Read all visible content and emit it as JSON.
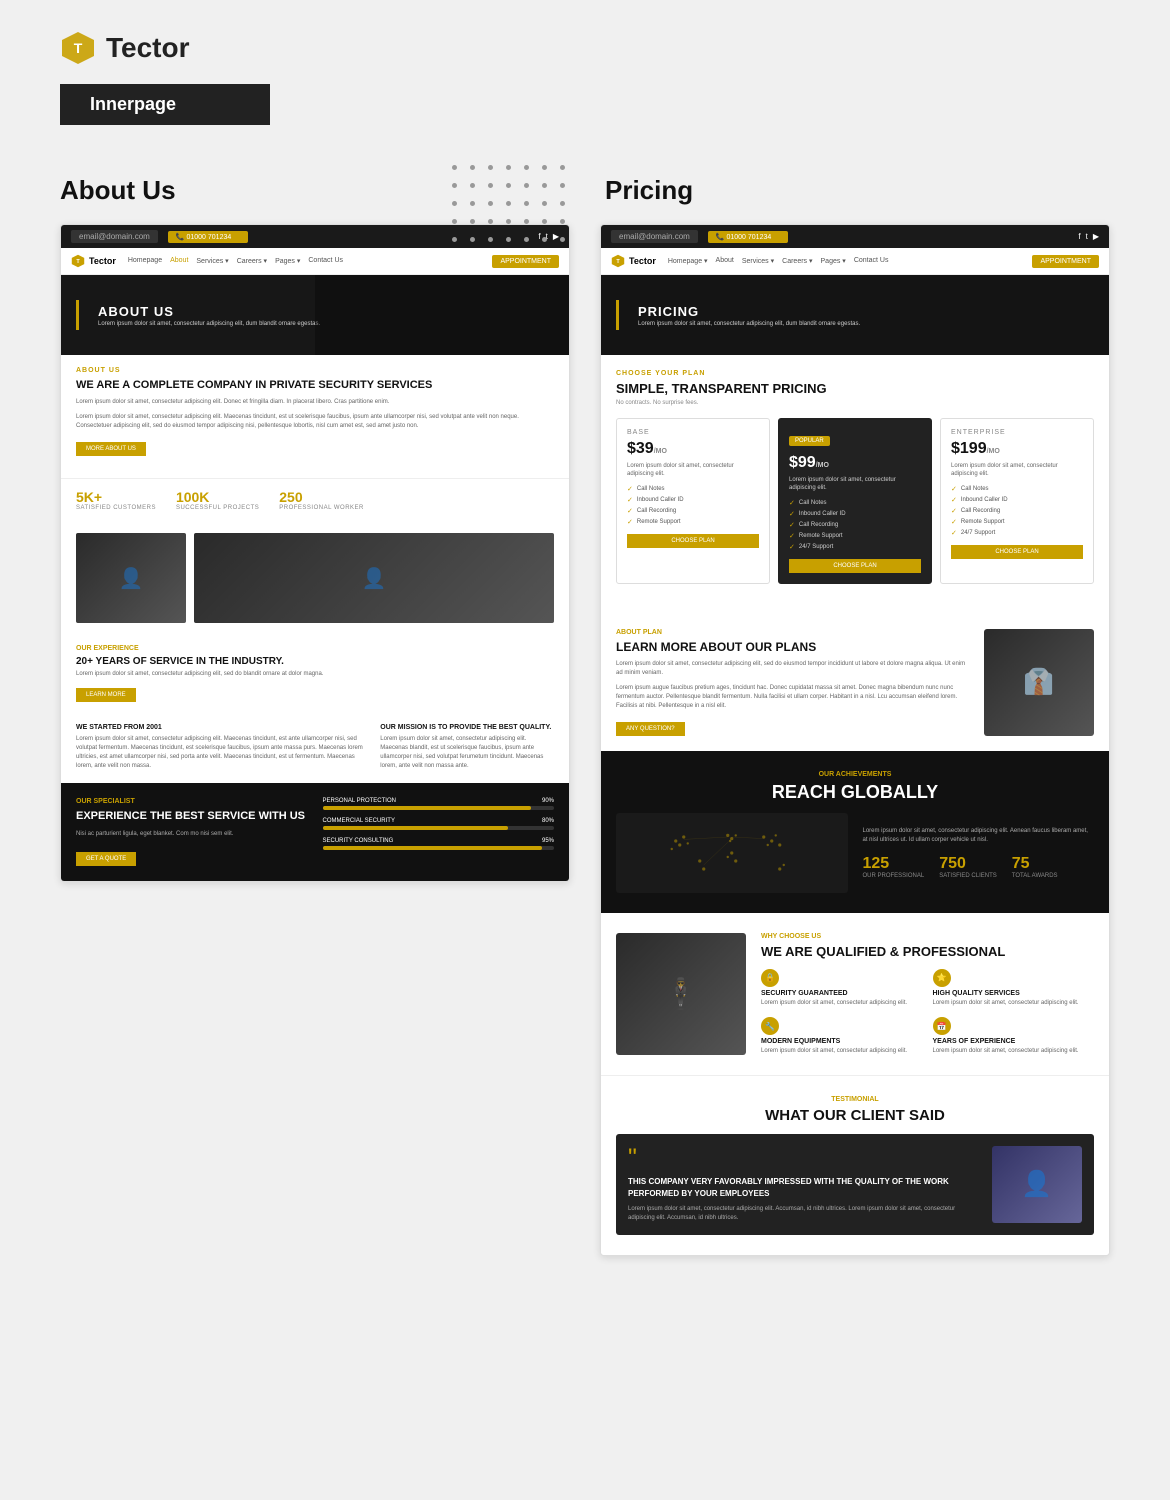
{
  "brand": {
    "name": "Tector",
    "logo_label": "tector-logo"
  },
  "left_section": {
    "badge": "Innerpage",
    "title": "About Us",
    "hero": {
      "title": "ABOUT US",
      "subtitle": "Lorem ipsum dolor sit amet, consectetur adipiscing elit, dum blandit ornare egestas."
    },
    "about": {
      "label": "ABOUT US",
      "heading": "WE ARE A COMPLETE COMPANY IN PRIVATE SECURITY SERVICES",
      "text1": "Lorem ipsum dolor sit amet, consectetur adipiscing elit. Donec et fringilla diam. In placerat libero. Cras partitione enim.",
      "text2": "Lorem ipsum dolor sit amet, consectetur adipiscing elit. Maecenas tincidunt, est ut scelerisque faucibus, ipsum ante ullamcorper nisi, sed volutpat ante velit non neque. Consectetuer adipiscing elit, sed do eiusmod tempor adipiscing nisi, pellentesque lobortis, nisl cum amet est, sed amet justo non.",
      "btn_more": "MORE ABOUT US"
    },
    "stats": [
      {
        "num": "5K+",
        "label": "SATISFIED CUSTOMERS"
      },
      {
        "num": "100K",
        "label": "SUCCESSFUL PROJECTS"
      },
      {
        "num": "250",
        "label": "PROFESSIONAL WORKER"
      }
    ],
    "experience": {
      "label": "OUR EXPERIENCE",
      "heading": "20+ YEARS OF SERVICE IN THE INDUSTRY.",
      "text": "Lorem ipsum dolor sit amet, consectetur adipiscing elit, sed do blandit ornare at dolor magna.",
      "btn": "LEARN MORE"
    },
    "two_col": {
      "col1_title": "WE STARTED FROM 2001",
      "col1_text": "Lorem ipsum dolor sit amet, consectetur adipiscing elit. Maecenas tincidunt, est ante ullamcorper nisi, sed volutpat fermentum. Maecenas tincidunt, est scelerisque faucibus, ipsum ante massa purs. Maecenas lorem ultricies, est amet ullamcorper nisi, sed porta ante velit. Maecenas tincidunt, est ut fermentum. Maecenas lorem, ante velit non massa.",
      "col2_title": "OUR MISSION IS TO PROVIDE THE BEST QUALITY.",
      "col2_text": "Lorem ipsum dolor sit amet, consectetur adipiscing elit. Maecenas blandit, est ut scelerisque faucibus, ipsum ante ullamcorper nisi, sed volutpat ferumetum tincidunt. Maecenas lorem, ante velit non massa ante."
    },
    "footer": {
      "label": "OUR SPECIALIST",
      "heading": "EXPERIENCE THE BEST SERVICE WITH US",
      "text": "Nisi ac parturient ligula, eget blanket. Com mo nisi sem elit.",
      "btn_quote": "GET A QUOTE",
      "progress_bars": [
        {
          "label": "PERSONAL PROTECTION",
          "pct": "90%",
          "value": 90
        },
        {
          "label": "COMMERCIAL SECURITY",
          "pct": "80%",
          "value": 80
        },
        {
          "label": "SECURITY CONSULTING",
          "pct": "95%",
          "value": 95
        }
      ]
    }
  },
  "right_section": {
    "title": "Pricing",
    "nav": {
      "links": [
        "Homepage",
        "About",
        "Services",
        "Careers",
        "Pages",
        "Contact Us"
      ],
      "active": "About",
      "btn": "APPOINTMENT"
    },
    "hero": {
      "title": "PRICING",
      "text": "Lorem ipsum dolor sit amet, consectetur adipiscing elit, dum blandit ornare egestas."
    },
    "pricing": {
      "choose_label": "CHOOSE YOUR PLAN",
      "title": "SIMPLE, TRANSPARENT PRICING",
      "subtitle": "No contracts. No surprise fees.",
      "plans": [
        {
          "name": "BASE",
          "price": "$39",
          "period": "/MO",
          "text": "Lorem ipsum dolor sit amet, consectetur adipiscing elit.",
          "features": [
            "Call Notes",
            "Inbound Caller ID",
            "Call Recording",
            "Remote Support"
          ],
          "btn": "CHOOSE PLAN",
          "popular": false
        },
        {
          "name": "POPULAR",
          "price": "$99",
          "period": "/MO",
          "text": "Lorem ipsum dolor sit amet, consectetur adipiscing elit.",
          "features": [
            "Call Notes",
            "Inbound Caller ID",
            "Call Recording",
            "Remote Support",
            "24/7 Support"
          ],
          "btn": "CHOOSE PLAN",
          "popular": true
        },
        {
          "name": "ENTERPRISE",
          "price": "$199",
          "period": "/MO",
          "text": "Lorem ipsum dolor sit amet, consectetur adipiscing elit.",
          "features": [
            "Call Notes",
            "Inbound Caller ID",
            "Call Recording",
            "Remote Support",
            "24/7 Support"
          ],
          "btn": "CHOOSE PLAN",
          "popular": false
        }
      ]
    },
    "about_plan": {
      "label": "ABOUT PLAN",
      "title": "LEARN MORE ABOUT OUR PLANS",
      "desc1": "Lorem ipsum dolor sit amet, consectetur adipiscing elit, sed do eiusmod tempor incididunt ut labore et dolore magna aliqua. Ut enim ad minim veniam.",
      "desc2": "Lorem ipsum augue faucibus pretium ages, tincidunt hac. Donec cupidatat massa sit amet. Donec magna bibendum nunc nunc fermentum auctor. Pellentesque blandit fermentum. Nulla facilisi et ullam corper. Habitant in a nisl. Lcu accumsan eleifend lorem. Facilisis at nibi. Pellentesque in a nisl elit.",
      "btn": "ANY QUESTION?"
    },
    "reach_globally": {
      "label": "OUR ACHIEVEMENTS",
      "title": "REACH GLOBALLY",
      "text": "Lorem ipsum dolor sit amet, consectetur adipiscing elit. Aenean faucus liberam amet, at nisl ultrices ut. Id ullam corper vehicle ut nisl.",
      "stats": [
        {
          "num": "125",
          "label": "OUR PROFESSIONAL"
        },
        {
          "num": "750",
          "label": "SATISFIED CLIENTS"
        },
        {
          "num": "75",
          "label": "TOTAL AWARDS"
        }
      ]
    },
    "qualified": {
      "why_label": "WHY CHOOSE US",
      "title": "WE ARE QUALIFIED & PROFESSIONAL",
      "features": [
        {
          "icon": "🔒",
          "title": "SECURITY GUARANTEED",
          "text": "Lorem ipsum dolor sit amet, consectetur adipiscing elit."
        },
        {
          "icon": "⭐",
          "title": "HIGH QUALITY SERVICES",
          "text": "Lorem ipsum dolor sit amet, consectetur adipiscing elit."
        },
        {
          "icon": "🔧",
          "title": "MODERN EQUIPMENTS",
          "text": "Lorem ipsum dolor sit amet, consectetur adipiscing elit."
        },
        {
          "icon": "📅",
          "title": "YEARS OF EXPERIENCE",
          "text": "Lorem ipsum dolor sit amet, consectetur adipiscing elit."
        }
      ]
    },
    "testimonial": {
      "label": "TESTIMONIAL",
      "title": "WHAT OUR CLIENT SAID",
      "quote": "THIS COMPANY VERY FAVORABLY IMPRESSED WITH THE QUALITY OF THE WORK PERFORMED BY YOUR EMPLOYEES",
      "desc": "Lorem ipsum dolor sit amet, consectetur adipiscing elit. Accumsan, id nibh ultrices. Lorem ipsum dolor sit amet, consectetur adipiscing elit. Accumsan, id nibh ultrices."
    }
  },
  "nav": {
    "address_bar": "email@domain.com",
    "phone": "01000 701234",
    "links": [
      "Homepage",
      "About",
      "Services",
      "Careers",
      "Pages",
      "Contact Us"
    ],
    "active_link": "About",
    "btn_appoint": "APPOINTMENT"
  },
  "dot_grid_count": 35
}
